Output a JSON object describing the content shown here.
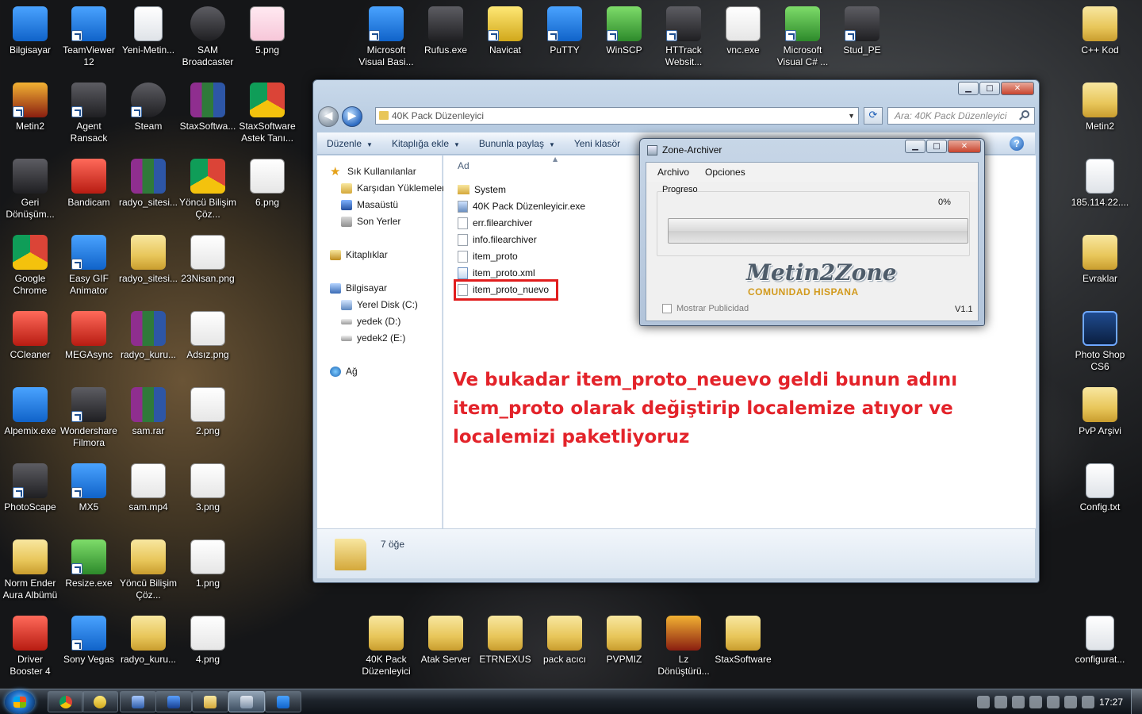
{
  "desktop": {
    "col1": [
      {
        "label": "Bilgisayar",
        "icon": "computer-icon"
      },
      {
        "label": "Metin2",
        "icon": "metin2-icon"
      },
      {
        "label": "Geri Dönüşüm...",
        "icon": "recycle-bin-icon"
      },
      {
        "label": "Google Chrome",
        "icon": "chrome-icon"
      },
      {
        "label": "CCleaner",
        "icon": "ccleaner-icon"
      },
      {
        "label": "Alpemix.exe",
        "icon": "alpemix-icon"
      },
      {
        "label": "PhotoScape",
        "icon": "photoscape-icon"
      },
      {
        "label": "Norm Ender Aura Albümü",
        "icon": "folder-icon"
      },
      {
        "label": "Driver Booster 4",
        "icon": "driver-booster-icon"
      }
    ],
    "col2": [
      {
        "label": "TeamViewer 12",
        "icon": "teamviewer-icon"
      },
      {
        "label": "Agent Ransack",
        "icon": "agent-ransack-icon"
      },
      {
        "label": "Bandicam",
        "icon": "bandicam-icon"
      },
      {
        "label": "Easy GIF Animator",
        "icon": "easy-gif-icon"
      },
      {
        "label": "MEGAsync",
        "icon": "megasync-icon"
      },
      {
        "label": "Wondershare Filmora",
        "icon": "filmora-icon"
      },
      {
        "label": "MX5",
        "icon": "mx5-icon"
      },
      {
        "label": "Resize.exe",
        "icon": "resize-icon"
      },
      {
        "label": "Sony Vegas",
        "icon": "sony-vegas-icon"
      }
    ],
    "col3": [
      {
        "label": "Yeni-Metin...",
        "icon": "text-file-icon"
      },
      {
        "label": "Steam",
        "icon": "steam-icon"
      },
      {
        "label": "radyo_sitesi...",
        "icon": "rar-icon"
      },
      {
        "label": "radyo_sitesi...",
        "icon": "folder-icon"
      },
      {
        "label": "radyo_kuru...",
        "icon": "rar-icon"
      },
      {
        "label": "sam.rar",
        "icon": "rar-icon"
      },
      {
        "label": "sam.mp4",
        "icon": "video-file-icon"
      },
      {
        "label": "Yöncü Bilişim Çöz...",
        "icon": "folder-icon"
      },
      {
        "label": "radyo_kuru...",
        "icon": "folder-icon"
      }
    ],
    "col4": [
      {
        "label": "SAM Broadcaster",
        "icon": "sam-broadcaster-icon"
      },
      {
        "label": "StaxSoftwa...",
        "icon": "rar-icon"
      },
      {
        "label": "Yöncü Bilişim Çöz...",
        "icon": "chrome-icon"
      },
      {
        "label": "23Nisan.png",
        "icon": "image-file-icon"
      },
      {
        "label": "Adsız.png",
        "icon": "image-file-icon"
      },
      {
        "label": "2.png",
        "icon": "image-file-icon"
      },
      {
        "label": "3.png",
        "icon": "image-file-icon"
      },
      {
        "label": "1.png",
        "icon": "image-file-icon"
      },
      {
        "label": "4.png",
        "icon": "image-file-icon"
      }
    ],
    "col5": [
      {
        "label": "5.png",
        "icon": "image-file-icon"
      },
      {
        "label": "StaxSoftware Astek Tanı...",
        "icon": "chrome-icon"
      },
      {
        "label": "6.png",
        "icon": "image-file-icon"
      }
    ],
    "top_row": [
      {
        "label": "Microsoft Visual Basi...",
        "icon": "visual-basic-icon"
      },
      {
        "label": "Rufus.exe",
        "icon": "rufus-icon"
      },
      {
        "label": "Navicat",
        "icon": "navicat-icon"
      },
      {
        "label": "PuTTY",
        "icon": "putty-icon"
      },
      {
        "label": "WinSCP",
        "icon": "winscp-icon"
      },
      {
        "label": "HTTrack Websit...",
        "icon": "httrack-icon"
      },
      {
        "label": "vnc.exe",
        "icon": "vnc-icon"
      },
      {
        "label": "Microsoft Visual C# ...",
        "icon": "visual-csharp-icon"
      },
      {
        "label": "Stud_PE",
        "icon": "stud-pe-icon"
      }
    ],
    "bottom_row": [
      {
        "label": "40K Pack Düzenleyici",
        "icon": "folder-icon"
      },
      {
        "label": "Atak Server",
        "icon": "folder-icon"
      },
      {
        "label": "ETRNEXUS",
        "icon": "folder-icon"
      },
      {
        "label": "pack acıcı",
        "icon": "folder-icon"
      },
      {
        "label": "PVPMIZ",
        "icon": "folder-icon"
      },
      {
        "label": "Lz Dönüştürü...",
        "icon": "metin2-icon"
      },
      {
        "label": "StaxSoftware",
        "icon": "folder-icon"
      }
    ],
    "right_col": [
      {
        "label": "C++ Kod",
        "icon": "folder-icon"
      },
      {
        "label": "Metin2",
        "icon": "folder-icon"
      },
      {
        "label": "185.114.22....",
        "icon": "text-file-icon"
      },
      {
        "label": "Evraklar",
        "icon": "folder-icon"
      },
      {
        "label": "Photo Shop CS6",
        "icon": "photoshop-icon"
      },
      {
        "label": "PvP Arşivi",
        "icon": "folder-icon"
      },
      {
        "label": "Config.txt",
        "icon": "text-file-icon"
      },
      {
        "label": "configurat...",
        "icon": "config-file-icon"
      }
    ]
  },
  "explorer": {
    "address": "40K Pack Düzenleyici",
    "search_placeholder": "Ara: 40K Pack Düzenleyici",
    "commands": [
      "Düzenle",
      "Kitaplığa ekle",
      "Bununla paylaş",
      "Yeni klasör"
    ],
    "nav": [
      {
        "label": "Sık Kullanılanlar",
        "icon": "star-icon"
      },
      {
        "label": "Karşıdan Yüklemeler",
        "icon": "downloads-icon"
      },
      {
        "label": "Masaüstü",
        "icon": "desktop-icon"
      },
      {
        "label": "Son Yerler",
        "icon": "recent-places-icon"
      },
      {
        "label": "Kitaplıklar",
        "icon": "libraries-icon"
      },
      {
        "label": "Bilgisayar",
        "icon": "computer-icon"
      },
      {
        "label": "Yerel Disk (C:)",
        "icon": "local-disk-icon"
      },
      {
        "label": "yedek (D:)",
        "icon": "drive-icon"
      },
      {
        "label": "yedek2 (E:)",
        "icon": "drive-icon"
      },
      {
        "label": "Ağ",
        "icon": "network-icon"
      }
    ],
    "column_header": "Ad",
    "files": [
      {
        "name": "System",
        "type": "folder"
      },
      {
        "name": "40K Pack Düzenleyicir.exe",
        "type": "exe"
      },
      {
        "name": "err.filearchiver",
        "type": "file"
      },
      {
        "name": "info.filearchiver",
        "type": "file"
      },
      {
        "name": "item_proto",
        "type": "file"
      },
      {
        "name": "item_proto.xml",
        "type": "xml"
      },
      {
        "name": "item_proto_nuevo",
        "type": "file"
      }
    ],
    "annotation": "Ve bukadar item_proto_neuevo geldi bunun adını item_proto olarak değiştirip localemize atıyor ve localemizi paketliyoruz",
    "item_count": "7 öğe"
  },
  "zone_archiver": {
    "title": "Zone-Archiver",
    "menu": [
      "Archivo",
      "Opciones"
    ],
    "progress_label": "Progreso",
    "progress_text": "0%",
    "progress_value": 0,
    "logo": "Metin2Zone",
    "logo_sub": "COMUNIDAD HISPANA",
    "checkbox_label": "Mostrar Publicidad",
    "version": "V1.1"
  },
  "taskbar": {
    "clock": "17:27"
  }
}
